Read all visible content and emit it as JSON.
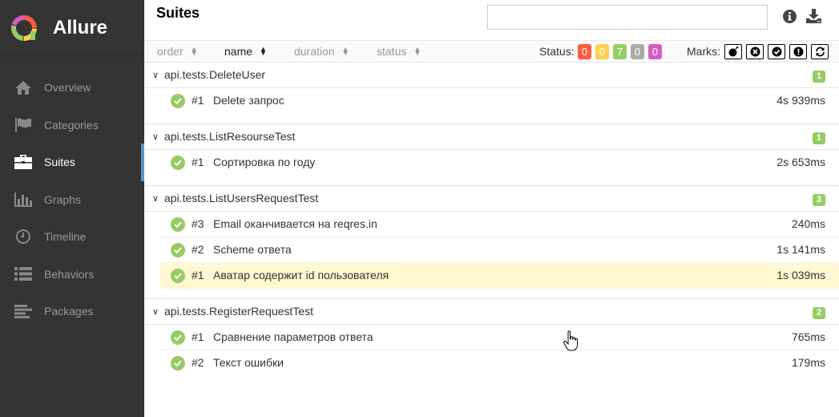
{
  "brand": {
    "name": "Allure"
  },
  "sidebar": {
    "items": [
      {
        "label": "Overview",
        "icon": "home-icon"
      },
      {
        "label": "Categories",
        "icon": "flag-icon"
      },
      {
        "label": "Suites",
        "icon": "briefcase-icon",
        "active": true
      },
      {
        "label": "Graphs",
        "icon": "bar-chart-icon"
      },
      {
        "label": "Timeline",
        "icon": "clock-icon"
      },
      {
        "label": "Behaviors",
        "icon": "list-icon"
      },
      {
        "label": "Packages",
        "icon": "align-left-icon"
      }
    ]
  },
  "header": {
    "title": "Suites",
    "search_value": ""
  },
  "toolbar": {
    "sort": [
      "order",
      "name",
      "duration",
      "status"
    ],
    "status_label": "Status:",
    "statuses": [
      {
        "name": "failed",
        "count": "0",
        "color": "#fd5a3e"
      },
      {
        "name": "broken",
        "count": "0",
        "color": "#ffd050"
      },
      {
        "name": "passed",
        "count": "7",
        "color": "#97cc64"
      },
      {
        "name": "skipped",
        "count": "0",
        "color": "#aaaaaa"
      },
      {
        "name": "unknown",
        "count": "0",
        "color": "#d35ebe"
      }
    ],
    "marks_label": "Marks:"
  },
  "groups": [
    {
      "name": "api.tests.DeleteUser",
      "count": "1",
      "rows": [
        {
          "num": "#1",
          "name": "Delete запрос",
          "duration": "4s 939ms"
        }
      ]
    },
    {
      "name": "api.tests.ListResourseTest",
      "count": "1",
      "rows": [
        {
          "num": "#1",
          "name": "Сортировка по году",
          "duration": "2s 653ms"
        }
      ]
    },
    {
      "name": "api.tests.ListUsersRequestTest",
      "count": "3",
      "rows": [
        {
          "num": "#3",
          "name": "Email оканчивается на reqres.in",
          "duration": "240ms"
        },
        {
          "num": "#2",
          "name": "Scheme ответа",
          "duration": "1s 141ms"
        },
        {
          "num": "#1",
          "name": "Аватар содержит id пользователя",
          "duration": "1s 039ms",
          "selected": true
        }
      ]
    },
    {
      "name": "api.tests.RegisterRequestTest",
      "count": "2",
      "rows": [
        {
          "num": "#1",
          "name": "Сравнение параметров ответа",
          "duration": "765ms"
        },
        {
          "num": "#2",
          "name": "Текст ошибки",
          "duration": "179ms"
        }
      ]
    }
  ]
}
